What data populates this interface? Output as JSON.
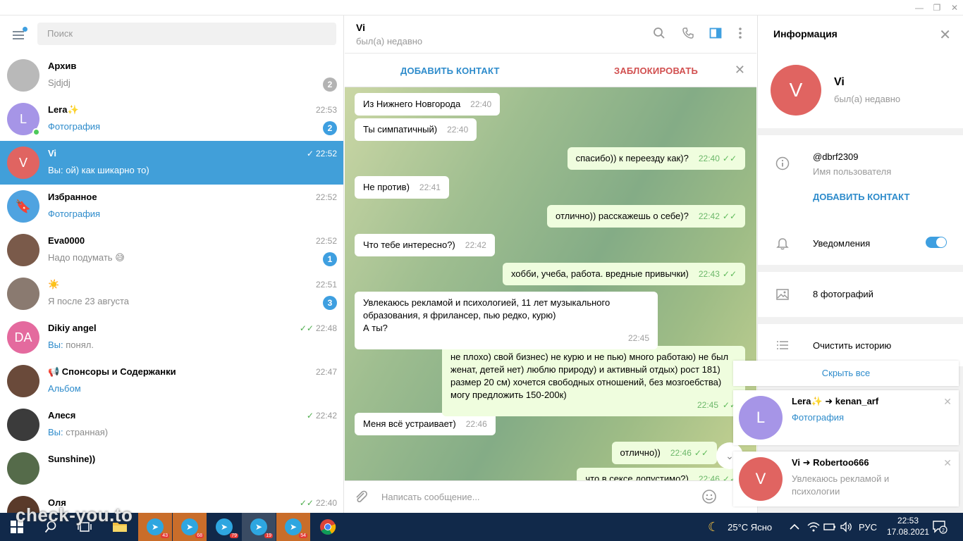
{
  "window": {
    "minimize": "—",
    "maximize": "❐",
    "close": "✕"
  },
  "search": {
    "placeholder": "Поиск"
  },
  "chats": [
    {
      "name": "Архив",
      "message": "Sjdjdj",
      "time": "",
      "badge": "2",
      "badge_muted": true,
      "avatar_letter": "",
      "avatar_color": "#b9b9b9"
    },
    {
      "name": "Lera✨",
      "message": "Фотография",
      "message_highlight": true,
      "time": "22:53",
      "badge": "2",
      "avatar_letter": "L",
      "avatar_color": "#a695e7",
      "online": true
    },
    {
      "name": "Vi",
      "message": "Вы: ой) как шикарно то)",
      "time": "22:52",
      "read": true,
      "active": true,
      "avatar_letter": "V",
      "avatar_color": "#e06461"
    },
    {
      "name": "Избранное",
      "message": "Фотография",
      "message_highlight": true,
      "time": "22:52",
      "avatar_letter": "🔖",
      "avatar_color": "#4fa3e0"
    },
    {
      "name": "Eva0000",
      "message": "Надо подумать 😅",
      "time": "22:52",
      "badge": "1",
      "avatar_letter": "",
      "avatar_color": "#7a5a4a"
    },
    {
      "name": "☀️",
      "message": "Я после 23 августа",
      "time": "22:51",
      "badge": "3",
      "avatar_letter": "",
      "avatar_color": "#8a7a70"
    },
    {
      "name": "Dikiy angel",
      "message_prefix": "Вы:",
      "message": " понял.",
      "time": "22:48",
      "read": true,
      "avatar_letter": "DA",
      "avatar_color": "#e46a9e"
    },
    {
      "name": "📢 Спонсоры и Содержанки",
      "message": "Альбом",
      "message_highlight": true,
      "time": "22:47",
      "avatar_letter": "",
      "avatar_color": "#6a4a3a"
    },
    {
      "name": "Алеся",
      "message_prefix": "Вы:",
      "message": " странная)",
      "time": "22:42",
      "read": true,
      "sent": true,
      "avatar_letter": "",
      "avatar_color": "#3b3b3b"
    },
    {
      "name": "Sunshine))",
      "message": "",
      "time": "",
      "avatar_letter": "",
      "avatar_color": "#556b4a"
    },
    {
      "name": "Оля",
      "message": "",
      "time": "22:40",
      "read": true,
      "avatar_letter": "",
      "avatar_color": "#5a3a2a"
    }
  ],
  "conversation": {
    "name": "Vi",
    "status": "был(а) недавно",
    "add_contact": "ДОБАВИТЬ КОНТАКТ",
    "block": "ЗАБЛОКИРОВАТЬ",
    "compose_placeholder": "Написать сообщение...",
    "messages": [
      {
        "text": "Из Нижнего Новгорода",
        "time": "22:40",
        "out": false
      },
      {
        "text": "Ты симпатичный)",
        "time": "22:40",
        "out": false
      },
      {
        "text": "спасибо)) к переезду как)?",
        "time": "22:40",
        "out": true
      },
      {
        "text": "Не против)",
        "time": "22:41",
        "out": false
      },
      {
        "text": "отлично)) расскажешь о себе)?",
        "time": "22:42",
        "out": true
      },
      {
        "text": "Что тебе интересно?)",
        "time": "22:42",
        "out": false
      },
      {
        "text": "хобби, учеба, работа. вредные привычки)",
        "time": "22:43",
        "out": true
      },
      {
        "text": "Увлекаюсь рекламой и психологией, 11 лет музыкального образования, я фрилансер, пью редко, курю)\nА ты?",
        "time": "22:45",
        "out": false
      },
      {
        "text": "не плохо) свой бизнес) не курю и не пью) много работаю) не был женат, детей нет) люблю природу) и активный отдых) рост 181) размер 20 см) хочется свободных отношений, без мозгоебства) могу предложить 150-200к)",
        "time": "22:45",
        "out": true
      },
      {
        "text": "Меня всё устраивает)",
        "time": "22:46",
        "out": false
      },
      {
        "text": "отлично))",
        "time": "22:46",
        "out": true
      },
      {
        "text": "что в сексе допустимо?)",
        "time": "22:46",
        "out": true
      }
    ]
  },
  "info": {
    "title": "Информация",
    "name": "Vi",
    "status": "был(а) недавно",
    "avatar_letter": "V",
    "username": "@dbrf2309",
    "username_label": "Имя пользователя",
    "add_contact": "ДОБАВИТЬ КОНТАКТ",
    "notifications": "Уведомления",
    "notifications_on": true,
    "photos": "8 фотографий",
    "clear_history": "Очистить историю"
  },
  "notifications": {
    "hide_all": "Скрыть все",
    "items": [
      {
        "title": "Lera✨ ➜ kenan_arf",
        "body": "Фотография",
        "body_highlight": true,
        "avatar_letter": "L",
        "avatar_color": "#a695e7"
      },
      {
        "title": "Vi ➜ Robertoo666",
        "body": "Увлекаюсь рекламой и психологии",
        "avatar_letter": "V",
        "avatar_color": "#e06461"
      }
    ]
  },
  "taskbar": {
    "weather": "25°C Ясно",
    "lang": "РУС",
    "time": "22:53",
    "date": "17.08.2021",
    "notif_count": "2",
    "telegram_counts": [
      "43",
      "68",
      "79",
      "19",
      "54"
    ]
  },
  "watermark": "check-you.to"
}
